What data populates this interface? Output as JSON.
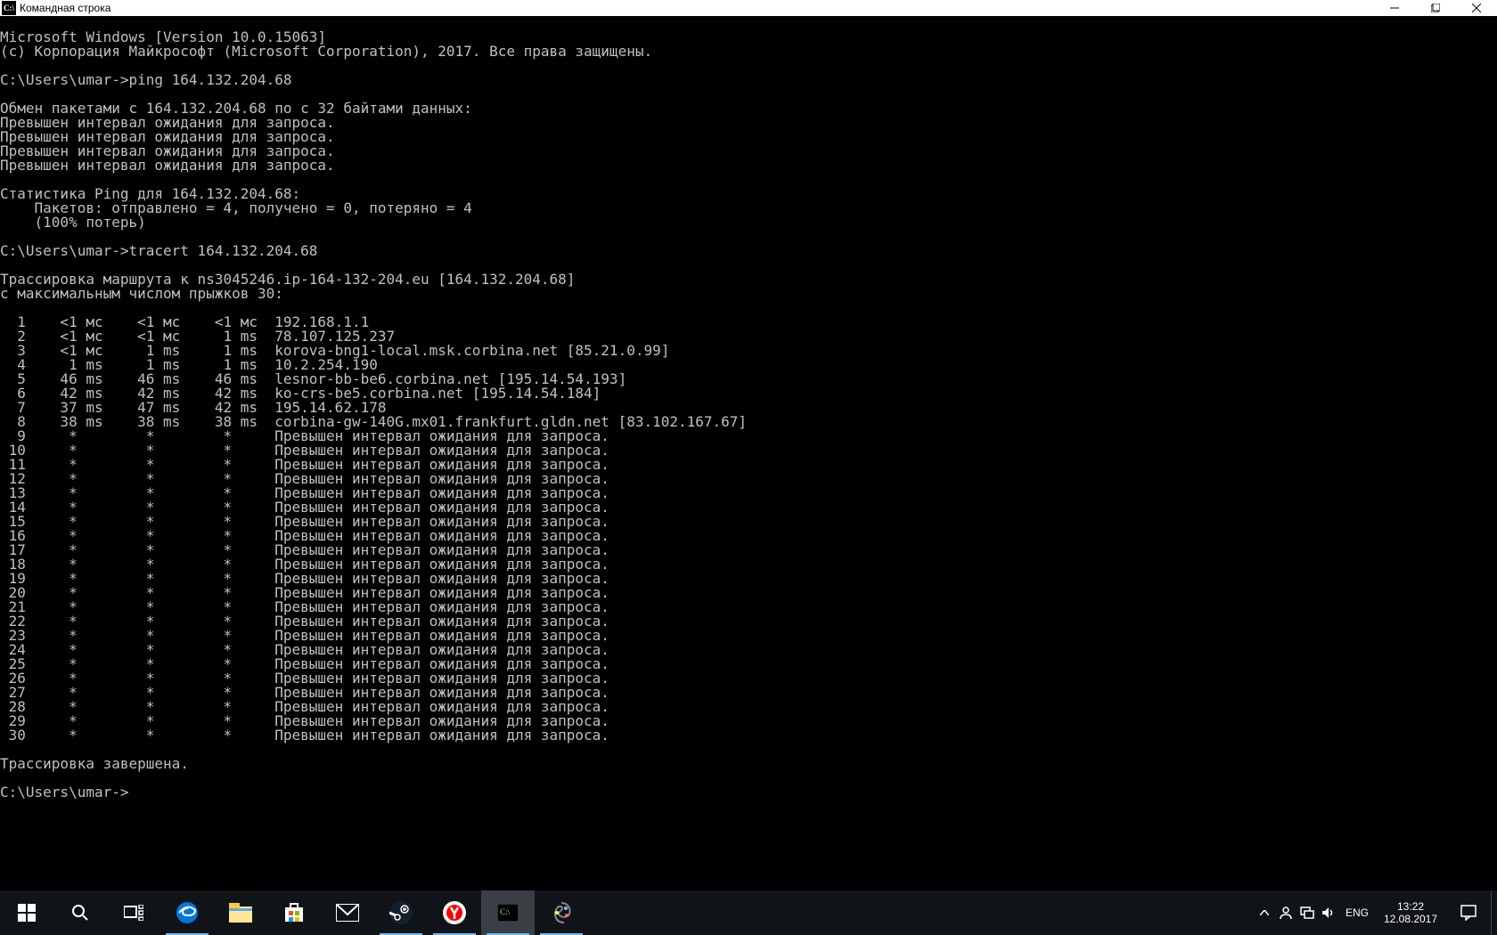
{
  "window": {
    "title": "Командная строка",
    "icon_text": "C:\\"
  },
  "terminal": {
    "header1": "Microsoft Windows [Version 10.0.15063]",
    "header2": "(с) Корпорация Майкрософт (Microsoft Corporation), 2017. Все права защищены.",
    "prompt": "C:\\Users\\umar->",
    "ping_cmd": "ping 164.132.204.68",
    "ping_exchange": "Обмен пакетами с 164.132.204.68 по с 32 байтами данных:",
    "timeout": "Превышен интервал ожидания для запроса.",
    "ping_stats_header": "Статистика Ping для 164.132.204.68:",
    "ping_stats_pkt": "    Пакетов: отправлено = 4, получено = 0, потеряно = 4",
    "ping_stats_loss": "    (100% потерь)",
    "tracert_cmd": "tracert 164.132.204.68",
    "trace_header1": "Трассировка маршрута к ns3045246.ip-164-132-204.eu [164.132.204.68]",
    "trace_header2": "с максимальным числом прыжков 30:",
    "trace_done": "Трассировка завершена.",
    "hops": [
      {
        "n": " 1",
        "c1": "   <1 мс",
        "c2": "   <1 мс",
        "c3": "   <1 мс",
        "host": "192.168.1.1"
      },
      {
        "n": " 2",
        "c1": "   <1 мс",
        "c2": "   <1 мс",
        "c3": "    1 ms",
        "host": "78.107.125.237"
      },
      {
        "n": " 3",
        "c1": "   <1 мс",
        "c2": "    1 ms",
        "c3": "    1 ms",
        "host": "korova-bng1-local.msk.corbina.net [85.21.0.99]"
      },
      {
        "n": " 4",
        "c1": "    1 ms",
        "c2": "    1 ms",
        "c3": "    1 ms",
        "host": "10.2.254.190"
      },
      {
        "n": " 5",
        "c1": "   46 ms",
        "c2": "   46 ms",
        "c3": "   46 ms",
        "host": "lesnor-bb-be6.corbina.net [195.14.54.193]"
      },
      {
        "n": " 6",
        "c1": "   42 ms",
        "c2": "   42 ms",
        "c3": "   42 ms",
        "host": "ko-crs-be5.corbina.net [195.14.54.184]"
      },
      {
        "n": " 7",
        "c1": "   37 ms",
        "c2": "   47 ms",
        "c3": "   42 ms",
        "host": "195.14.62.178"
      },
      {
        "n": " 8",
        "c1": "   38 ms",
        "c2": "   38 ms",
        "c3": "   38 ms",
        "host": "corbina-gw-140G.mx01.frankfurt.gldn.net [83.102.167.67]"
      },
      {
        "n": " 9",
        "c1": "    *   ",
        "c2": "    *   ",
        "c3": "    *   ",
        "host": "Превышен интервал ожидания для запроса."
      },
      {
        "n": "10",
        "c1": "    *   ",
        "c2": "    *   ",
        "c3": "    *   ",
        "host": "Превышен интервал ожидания для запроса."
      },
      {
        "n": "11",
        "c1": "    *   ",
        "c2": "    *   ",
        "c3": "    *   ",
        "host": "Превышен интервал ожидания для запроса."
      },
      {
        "n": "12",
        "c1": "    *   ",
        "c2": "    *   ",
        "c3": "    *   ",
        "host": "Превышен интервал ожидания для запроса."
      },
      {
        "n": "13",
        "c1": "    *   ",
        "c2": "    *   ",
        "c3": "    *   ",
        "host": "Превышен интервал ожидания для запроса."
      },
      {
        "n": "14",
        "c1": "    *   ",
        "c2": "    *   ",
        "c3": "    *   ",
        "host": "Превышен интервал ожидания для запроса."
      },
      {
        "n": "15",
        "c1": "    *   ",
        "c2": "    *   ",
        "c3": "    *   ",
        "host": "Превышен интервал ожидания для запроса."
      },
      {
        "n": "16",
        "c1": "    *   ",
        "c2": "    *   ",
        "c3": "    *   ",
        "host": "Превышен интервал ожидания для запроса."
      },
      {
        "n": "17",
        "c1": "    *   ",
        "c2": "    *   ",
        "c3": "    *   ",
        "host": "Превышен интервал ожидания для запроса."
      },
      {
        "n": "18",
        "c1": "    *   ",
        "c2": "    *   ",
        "c3": "    *   ",
        "host": "Превышен интервал ожидания для запроса."
      },
      {
        "n": "19",
        "c1": "    *   ",
        "c2": "    *   ",
        "c3": "    *   ",
        "host": "Превышен интервал ожидания для запроса."
      },
      {
        "n": "20",
        "c1": "    *   ",
        "c2": "    *   ",
        "c3": "    *   ",
        "host": "Превышен интервал ожидания для запроса."
      },
      {
        "n": "21",
        "c1": "    *   ",
        "c2": "    *   ",
        "c3": "    *   ",
        "host": "Превышен интервал ожидания для запроса."
      },
      {
        "n": "22",
        "c1": "    *   ",
        "c2": "    *   ",
        "c3": "    *   ",
        "host": "Превышен интервал ожидания для запроса."
      },
      {
        "n": "23",
        "c1": "    *   ",
        "c2": "    *   ",
        "c3": "    *   ",
        "host": "Превышен интервал ожидания для запроса."
      },
      {
        "n": "24",
        "c1": "    *   ",
        "c2": "    *   ",
        "c3": "    *   ",
        "host": "Превышен интервал ожидания для запроса."
      },
      {
        "n": "25",
        "c1": "    *   ",
        "c2": "    *   ",
        "c3": "    *   ",
        "host": "Превышен интервал ожидания для запроса."
      },
      {
        "n": "26",
        "c1": "    *   ",
        "c2": "    *   ",
        "c3": "    *   ",
        "host": "Превышен интервал ожидания для запроса."
      },
      {
        "n": "27",
        "c1": "    *   ",
        "c2": "    *   ",
        "c3": "    *   ",
        "host": "Превышен интервал ожидания для запроса."
      },
      {
        "n": "28",
        "c1": "    *   ",
        "c2": "    *   ",
        "c3": "    *   ",
        "host": "Превышен интервал ожидания для запроса."
      },
      {
        "n": "29",
        "c1": "    *   ",
        "c2": "    *   ",
        "c3": "    *   ",
        "host": "Превышен интервал ожидания для запроса."
      },
      {
        "n": "30",
        "c1": "    *   ",
        "c2": "    *   ",
        "c3": "    *   ",
        "host": "Превышен интервал ожидания для запроса."
      }
    ]
  },
  "taskbar": {
    "lang": "ENG",
    "time": "13:22",
    "date": "12.08.2017"
  }
}
